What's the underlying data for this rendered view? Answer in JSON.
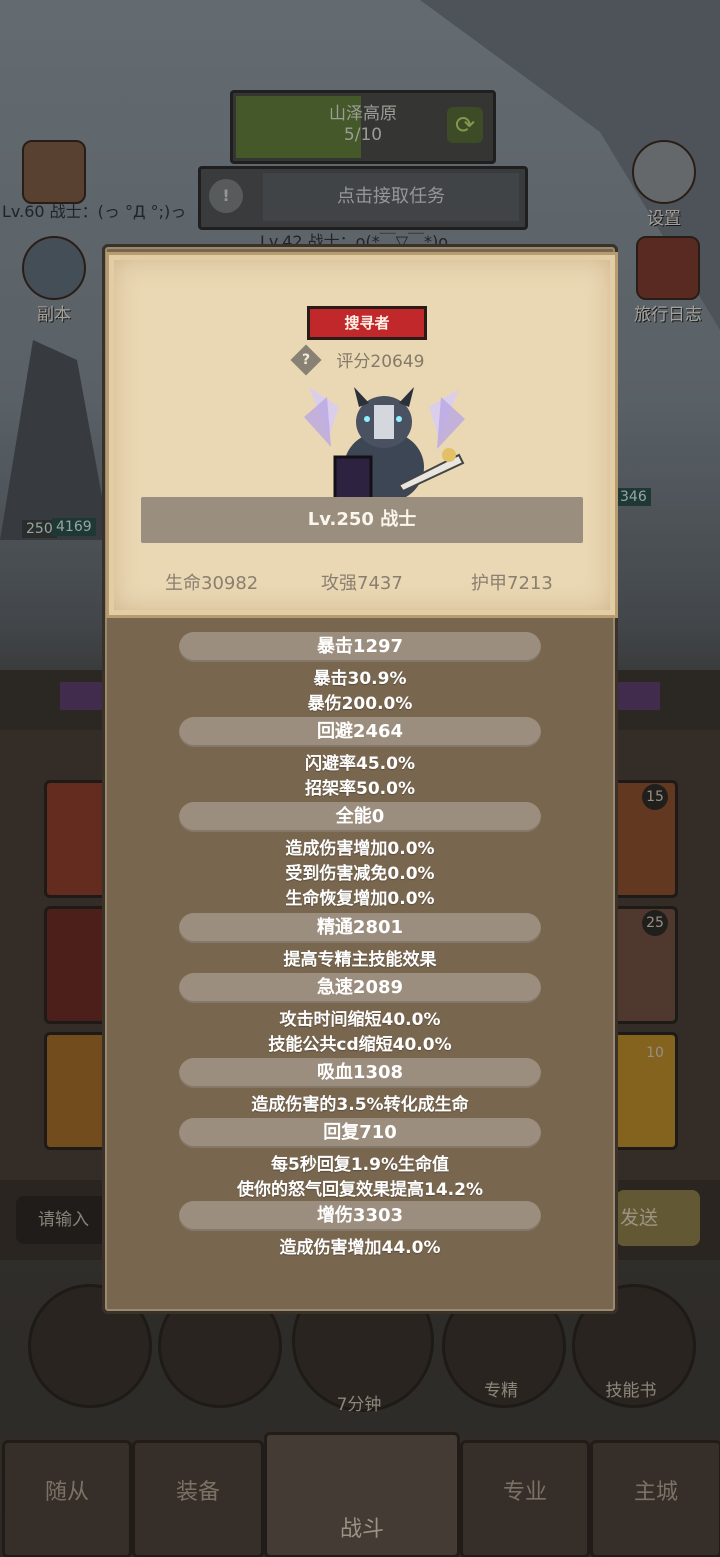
{
  "background": {
    "zone_name": "山泽高原",
    "zone_progress": "5/10",
    "quest_label": "点击接取任务",
    "player_line": "Lv.60 战士：(っ °Д °;)っ",
    "other_player_line": "Lv.42 战士：o(*￣▽￣*)o",
    "left_icons": [
      "副本"
    ],
    "right_icons": [
      "设置",
      "旅行日志"
    ],
    "enemy_level": "250",
    "enemy_hp": "4169",
    "right_hp": "346",
    "slot_badges": [
      "15",
      "25",
      "10"
    ],
    "input_placeholder": "请输入",
    "send_label": "发送",
    "timer_label": "7分钟",
    "action_labels": [
      "专精",
      "技能书"
    ],
    "nav": [
      "随从",
      "装备",
      "战斗",
      "专业",
      "主城"
    ]
  },
  "dialog": {
    "tag": "搜寻者",
    "score": "评分20649",
    "hero_name": "Lv.250 战士",
    "summary": [
      "生命30982",
      "攻强7437",
      "护甲7213"
    ],
    "stats": [
      {
        "name": "暴击1297",
        "details": [
          "暴击30.9%",
          "暴伤200.0%"
        ]
      },
      {
        "name": "回避2464",
        "details": [
          "闪避率45.0%",
          "招架率50.0%"
        ]
      },
      {
        "name": "全能0",
        "details": [
          "造成伤害增加0.0%",
          "受到伤害减免0.0%",
          "生命恢复增加0.0%"
        ]
      },
      {
        "name": "精通2801",
        "details": [
          "提高专精主技能效果"
        ]
      },
      {
        "name": "急速2089",
        "details": [
          "攻击时间缩短40.0%",
          "技能公共cd缩短40.0%"
        ]
      },
      {
        "name": "吸血1308",
        "details": [
          "造成伤害的3.5%转化成生命"
        ]
      },
      {
        "name": "回复710",
        "details": [
          "每5秒回复1.9%生命值",
          "使你的怒气回复效果提高14.2%"
        ]
      },
      {
        "name": "增伤3303",
        "details": [
          "造成伤害增加44.0%"
        ]
      }
    ]
  }
}
